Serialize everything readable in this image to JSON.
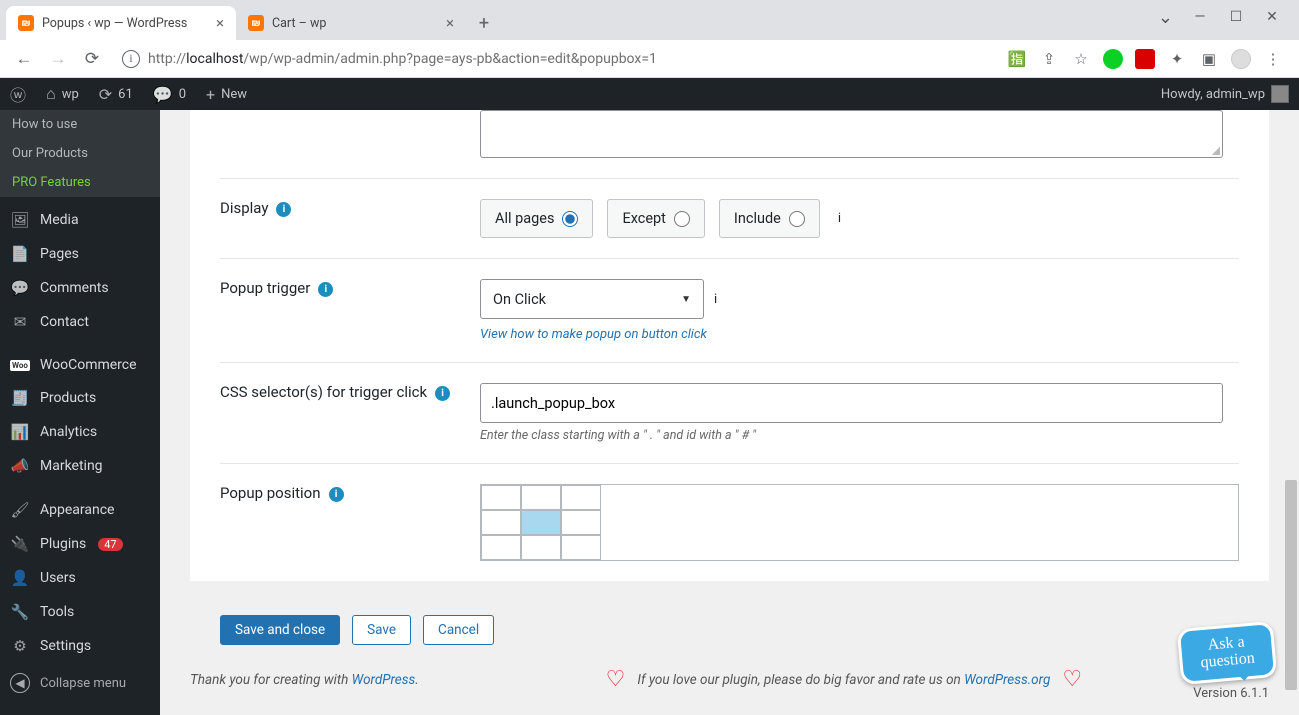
{
  "window": {
    "tabs": [
      {
        "title": "Popups ‹ wp — WordPress"
      },
      {
        "title": "Cart – wp"
      }
    ]
  },
  "toolbar": {
    "url_pre": "http://",
    "url_host": "localhost",
    "url_rest": "/wp/wp-admin/admin.php?page=ays-pb&action=edit&popupbox=1"
  },
  "adminbar": {
    "site": "wp",
    "updates": "61",
    "comments": "0",
    "new": "New",
    "howdy": "Howdy, admin_wp"
  },
  "sidebar": {
    "subs": [
      "How to use",
      "Our Products",
      "PRO Features"
    ],
    "items": [
      {
        "icon": "🖼",
        "label": "Media"
      },
      {
        "icon": "📄",
        "label": "Pages"
      },
      {
        "icon": "💬",
        "label": "Comments"
      },
      {
        "icon": "✉",
        "label": "Contact"
      },
      {
        "icon": "Woo",
        "label": "WooCommerce"
      },
      {
        "icon": "🧾",
        "label": "Products"
      },
      {
        "icon": "📊",
        "label": "Analytics"
      },
      {
        "icon": "📣",
        "label": "Marketing"
      },
      {
        "icon": "🖌",
        "label": "Appearance"
      },
      {
        "icon": "🔌",
        "label": "Plugins",
        "badge": "47"
      },
      {
        "icon": "👤",
        "label": "Users"
      },
      {
        "icon": "🔧",
        "label": "Tools"
      },
      {
        "icon": "⚙",
        "label": "Settings"
      }
    ],
    "collapse": "Collapse menu"
  },
  "form": {
    "display": {
      "label": "Display",
      "opt_all": "All pages",
      "opt_except": "Except",
      "opt_include": "Include"
    },
    "trigger": {
      "label": "Popup trigger",
      "value": "On Click",
      "link": "View how to make popup on button click"
    },
    "css": {
      "label": "CSS selector(s) for trigger click",
      "value": ".launch_popup_box",
      "hint": "Enter the class starting with a \" . \" and id with a \" # \""
    },
    "position": {
      "label": "Popup position"
    },
    "buttons": {
      "save_close": "Save and close",
      "save": "Save",
      "cancel": "Cancel"
    }
  },
  "footer": {
    "rate_text": "If you love our plugin, please do big favor and rate us on ",
    "rate_link": "WordPress.org",
    "thank_pre": "Thank you for creating with ",
    "thank_link": "WordPress",
    "version": "Version 6.1.1"
  },
  "ask": "Ask a\nquestion"
}
